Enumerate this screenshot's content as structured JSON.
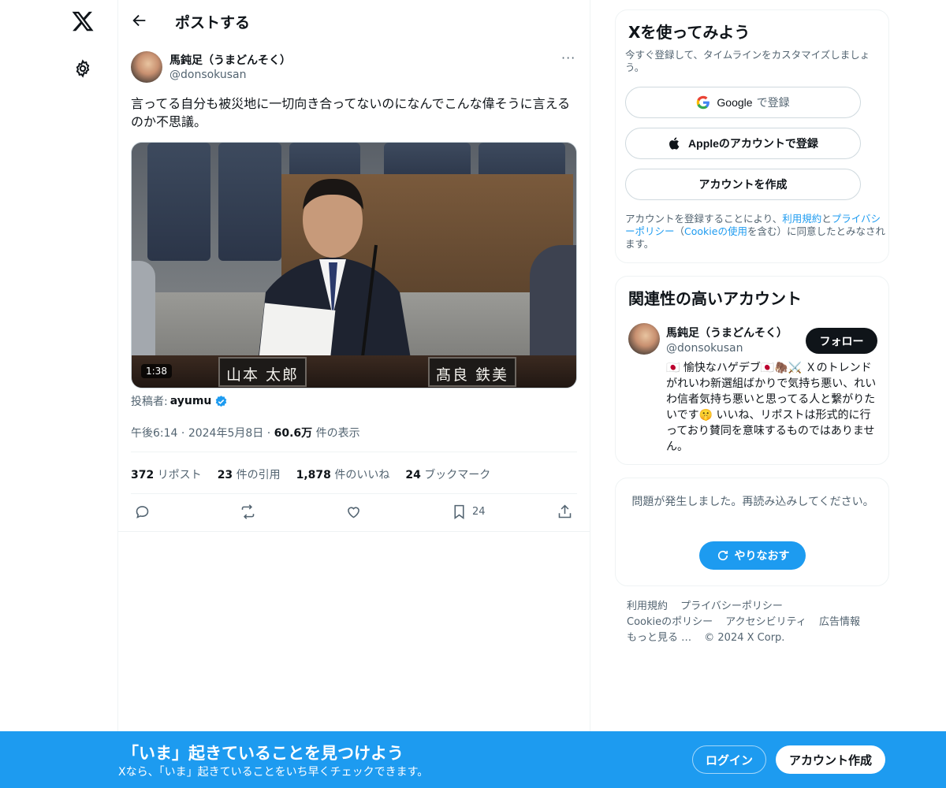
{
  "nav": {
    "logo": "X",
    "settings_icon": "gear-icon"
  },
  "header": {
    "title": "ポストする"
  },
  "post": {
    "author_name": "馬鈍足（うまどんそく）",
    "author_handle": "@donsokusan",
    "more": "···",
    "text": "言ってる自分も被災地に一切向き合ってないのになんでこんな偉そうに言えるのか不思議。",
    "video": {
      "duration": "1:38",
      "nameplate_left": "山本 太郎",
      "nameplate_right": "髙良 鉄美"
    },
    "posted_by_label": "投稿者:",
    "posted_by_name": "ayumu",
    "time": "午後6:14",
    "date": "2024年5月8日",
    "sep": "·",
    "views_count": "60.6万",
    "views_label": "件の表示",
    "stats": {
      "reposts_count": "372",
      "reposts_label": "リポスト",
      "quotes_count": "23",
      "quotes_label": "件の引用",
      "likes_count": "1,878",
      "likes_label": "件のいいね",
      "bookmarks_count": "24",
      "bookmarks_label": "ブックマーク"
    },
    "action_bookmark_count": "24"
  },
  "signup_card": {
    "title": "Xを使ってみよう",
    "subtitle": "今すぐ登録して、タイムラインをカスタマイズしましょう。",
    "google_label": "Google",
    "google_suffix": "で登録",
    "apple_label": "Appleのアカウントで登録",
    "create_label": "アカウントを作成",
    "legal_pre": "アカウントを登録することにより、",
    "legal_terms": "利用規約",
    "legal_and": "と",
    "legal_privacy": "プライバシーポリシー",
    "legal_mid": "（",
    "legal_cookie": "Cookieの使用",
    "legal_post": "を含む）に同意したとみなされます。"
  },
  "related_card": {
    "title": "関連性の高いアカウント",
    "name": "馬鈍足（うまどんそく）",
    "handle": "@donsokusan",
    "follow_label": "フォロー",
    "bio": "🇯🇵 愉快なハゲデブ🇯🇵🦣⚔️ Ｘのトレンドがれいわ新選組ばかりで気持ち悪い、れいわ信者気持ち悪いと思ってる人と繋がりたいです🤫 いいね、リポストは形式的に行っており賛同を意味するものではありません。"
  },
  "error_card": {
    "text": "問題が発生しました。再読み込みしてください。",
    "retry_label": "やりなおす"
  },
  "footer": {
    "links": [
      "利用規約",
      "プライバシーポリシー",
      "Cookieのポリシー",
      "アクセシビリティ",
      "広告情報",
      "もっと見る …",
      "© 2024 X Corp."
    ]
  },
  "banner": {
    "title": "「いま」起きていることを見つけよう",
    "subtitle": "Xなら、「いま」起きていることをいち早くチェックできます。",
    "login_label": "ログイン",
    "signup_label": "アカウント作成"
  },
  "colors": {
    "accent": "#1d9bf0",
    "text": "#0f1419",
    "muted": "#536471",
    "border": "#eff3f4"
  }
}
